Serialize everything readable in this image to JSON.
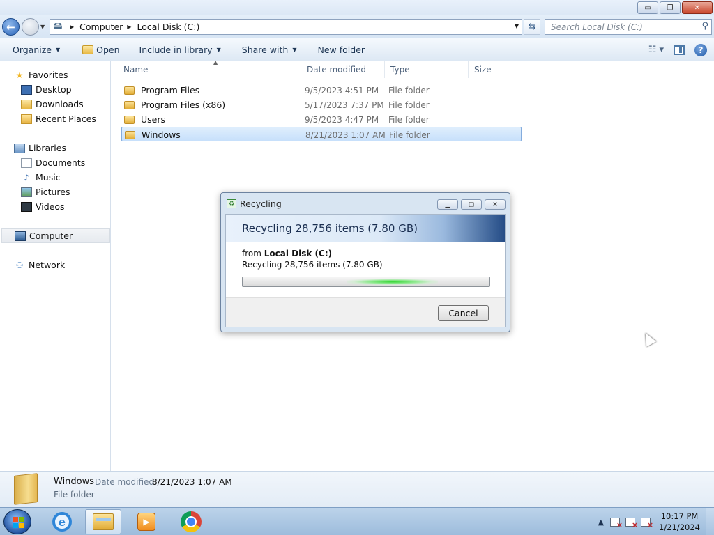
{
  "window": {
    "caption_buttons": {
      "minimize": "▭",
      "maximize": "❐",
      "close": "✕"
    }
  },
  "address": {
    "crumbs": [
      "Computer",
      "Local Disk (C:)"
    ],
    "search_placeholder": "Search Local Disk (C:)"
  },
  "toolbar": {
    "organize": "Organize",
    "open": "Open",
    "include_in_library": "Include in library",
    "share_with": "Share with",
    "new_folder": "New folder"
  },
  "nav": {
    "favorites": {
      "label": "Favorites",
      "items": [
        "Desktop",
        "Downloads",
        "Recent Places"
      ]
    },
    "libraries": {
      "label": "Libraries",
      "items": [
        "Documents",
        "Music",
        "Pictures",
        "Videos"
      ]
    },
    "computer": "Computer",
    "network": "Network"
  },
  "columns": {
    "name": "Name",
    "date_modified": "Date modified",
    "type": "Type",
    "size": "Size"
  },
  "files": [
    {
      "name": "Program Files",
      "date": "9/5/2023 4:51 PM",
      "type": "File folder",
      "selected": false
    },
    {
      "name": "Program Files (x86)",
      "date": "5/17/2023 7:37 PM",
      "type": "File folder",
      "selected": false
    },
    {
      "name": "Users",
      "date": "9/5/2023 4:47 PM",
      "type": "File folder",
      "selected": false
    },
    {
      "name": "Windows",
      "date": "8/21/2023 1:07 AM",
      "type": "File folder",
      "selected": true
    }
  ],
  "details": {
    "name": "Windows",
    "date_label": "Date modified:",
    "date_value": "8/21/2023 1:07 AM",
    "type": "File folder"
  },
  "dialog": {
    "title": "Recycling",
    "heading": "Recycling 28,756 items (7.80 GB)",
    "from_prefix": "from",
    "from_location": "Local Disk (C:)",
    "status": "Recycling 28,756 items (7.80 GB)",
    "progress_state": "indeterminate",
    "cancel": "Cancel"
  },
  "taskbar": {
    "apps": [
      "internet-explorer",
      "windows-explorer",
      "windows-media-player",
      "google-chrome"
    ],
    "clock_time": "10:17 PM",
    "clock_date": "1/21/2024"
  }
}
